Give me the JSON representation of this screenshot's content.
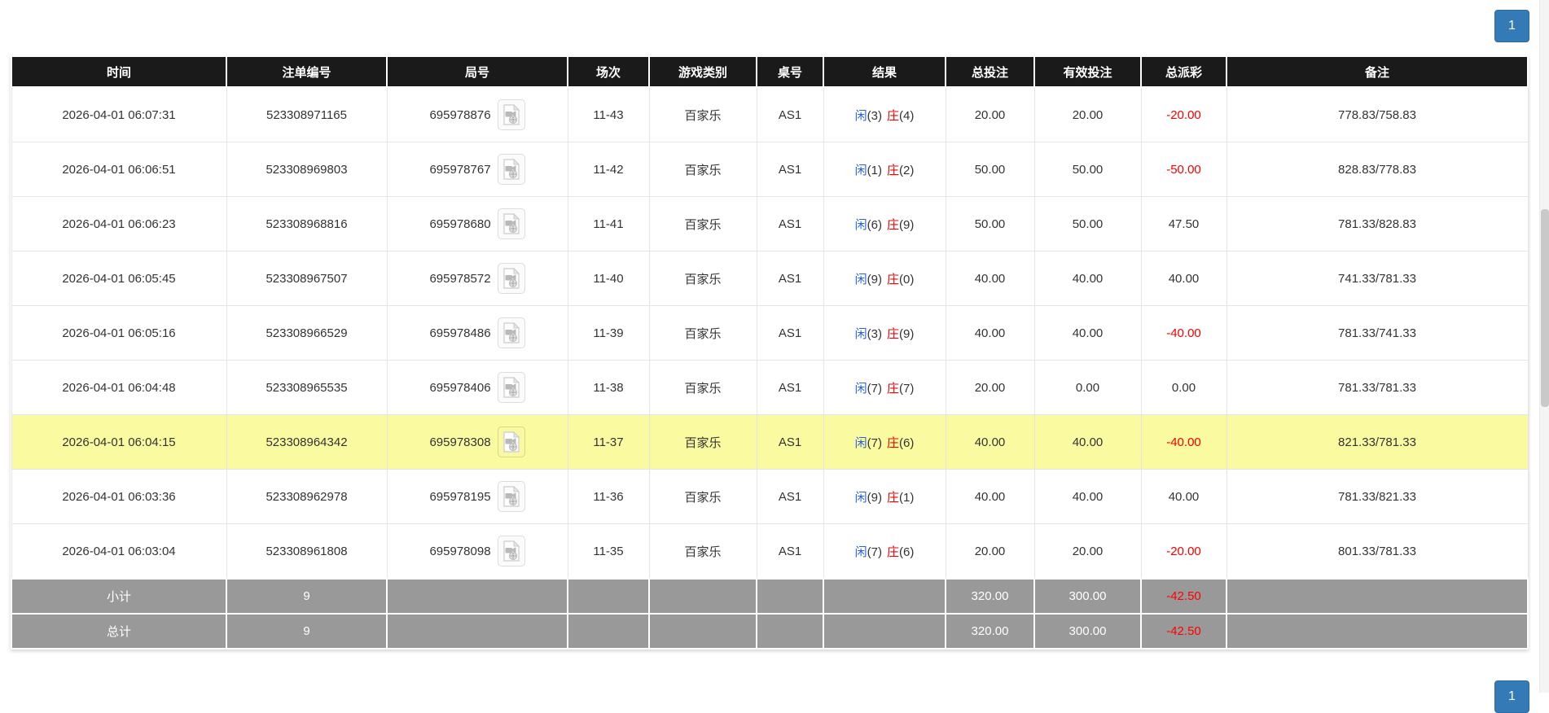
{
  "pagination": {
    "top": {
      "label": "1"
    },
    "bottom": {
      "label": "1"
    }
  },
  "table": {
    "headers": {
      "time": "时间",
      "bet_id": "注单编号",
      "round": "局号",
      "session": "场次",
      "game_type": "游戏类别",
      "table_no": "桌号",
      "result": "结果",
      "total_bet": "总投注",
      "valid_bet": "有效投注",
      "payout": "总派彩",
      "remark": "备注"
    },
    "rows": [
      {
        "time": "2026-04-01 06:07:31",
        "bet_id": "523308971165",
        "round": "695978876",
        "session": "11-43",
        "game_type": "百家乐",
        "table_no": "AS1",
        "xian_label": "闲",
        "xian_score": "(3)",
        "zhuang_label": "庄",
        "zhuang_score": "(4)",
        "total_bet": "20.00",
        "valid_bet": "20.00",
        "payout": "-20.00",
        "remark": "778.83/758.83",
        "highlighted": false
      },
      {
        "time": "2026-04-01 06:06:51",
        "bet_id": "523308969803",
        "round": "695978767",
        "session": "11-42",
        "game_type": "百家乐",
        "table_no": "AS1",
        "xian_label": "闲",
        "xian_score": "(1)",
        "zhuang_label": "庄",
        "zhuang_score": "(2)",
        "total_bet": "50.00",
        "valid_bet": "50.00",
        "payout": "-50.00",
        "remark": "828.83/778.83",
        "highlighted": false
      },
      {
        "time": "2026-04-01 06:06:23",
        "bet_id": "523308968816",
        "round": "695978680",
        "session": "11-41",
        "game_type": "百家乐",
        "table_no": "AS1",
        "xian_label": "闲",
        "xian_score": "(6)",
        "zhuang_label": "庄",
        "zhuang_score": "(9)",
        "total_bet": "50.00",
        "valid_bet": "50.00",
        "payout": "47.50",
        "remark": "781.33/828.83",
        "highlighted": false
      },
      {
        "time": "2026-04-01 06:05:45",
        "bet_id": "523308967507",
        "round": "695978572",
        "session": "11-40",
        "game_type": "百家乐",
        "table_no": "AS1",
        "xian_label": "闲",
        "xian_score": "(9)",
        "zhuang_label": "庄",
        "zhuang_score": "(0)",
        "total_bet": "40.00",
        "valid_bet": "40.00",
        "payout": "40.00",
        "remark": "741.33/781.33",
        "highlighted": false
      },
      {
        "time": "2026-04-01 06:05:16",
        "bet_id": "523308966529",
        "round": "695978486",
        "session": "11-39",
        "game_type": "百家乐",
        "table_no": "AS1",
        "xian_label": "闲",
        "xian_score": "(3)",
        "zhuang_label": "庄",
        "zhuang_score": "(9)",
        "total_bet": "40.00",
        "valid_bet": "40.00",
        "payout": "-40.00",
        "remark": "781.33/741.33",
        "highlighted": false
      },
      {
        "time": "2026-04-01 06:04:48",
        "bet_id": "523308965535",
        "round": "695978406",
        "session": "11-38",
        "game_type": "百家乐",
        "table_no": "AS1",
        "xian_label": "闲",
        "xian_score": "(7)",
        "zhuang_label": "庄",
        "zhuang_score": "(7)",
        "total_bet": "20.00",
        "valid_bet": "0.00",
        "payout": "0.00",
        "remark": "781.33/781.33",
        "highlighted": false
      },
      {
        "time": "2026-04-01 06:04:15",
        "bet_id": "523308964342",
        "round": "695978308",
        "session": "11-37",
        "game_type": "百家乐",
        "table_no": "AS1",
        "xian_label": "闲",
        "xian_score": "(7)",
        "zhuang_label": "庄",
        "zhuang_score": "(6)",
        "total_bet": "40.00",
        "valid_bet": "40.00",
        "payout": "-40.00",
        "remark": "821.33/781.33",
        "highlighted": true
      },
      {
        "time": "2026-04-01 06:03:36",
        "bet_id": "523308962978",
        "round": "695978195",
        "session": "11-36",
        "game_type": "百家乐",
        "table_no": "AS1",
        "xian_label": "闲",
        "xian_score": "(9)",
        "zhuang_label": "庄",
        "zhuang_score": "(1)",
        "total_bet": "40.00",
        "valid_bet": "40.00",
        "payout": "40.00",
        "remark": "781.33/821.33",
        "highlighted": false
      },
      {
        "time": "2026-04-01 06:03:04",
        "bet_id": "523308961808",
        "round": "695978098",
        "session": "11-35",
        "game_type": "百家乐",
        "table_no": "AS1",
        "xian_label": "闲",
        "xian_score": "(7)",
        "zhuang_label": "庄",
        "zhuang_score": "(6)",
        "total_bet": "20.00",
        "valid_bet": "20.00",
        "payout": "-20.00",
        "remark": "801.33/781.33",
        "highlighted": false
      }
    ],
    "summary_rows": [
      {
        "label": "小计",
        "count": "9",
        "total_bet": "320.00",
        "valid_bet": "300.00",
        "payout": "-42.50"
      },
      {
        "label": "总计",
        "count": "9",
        "total_bet": "320.00",
        "valid_bet": "300.00",
        "payout": "-42.50"
      }
    ]
  },
  "colors": {
    "header_bg": "#1a1a1a",
    "highlight_yellow": "#fafaa0",
    "summary_gray": "#999999",
    "bet_blue": "#2a62dd",
    "loss_red": "#f30000",
    "pagination_blue": "#337ab7"
  }
}
